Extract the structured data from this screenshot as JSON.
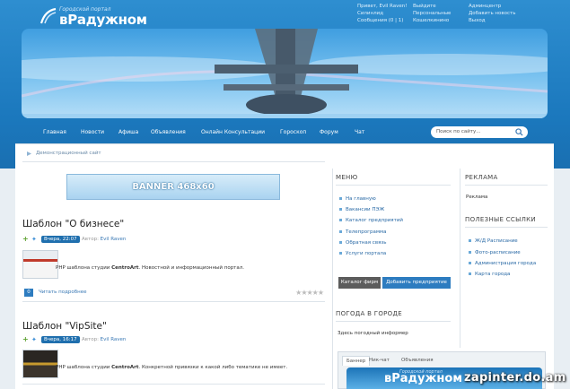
{
  "site": {
    "logo_subtitle": "Городской портал",
    "logo_title": "вРадужном"
  },
  "user_panel": {
    "col1": [
      "Привет, Evil Raven!",
      "Силинлид",
      "Сообщения (0 | 1)"
    ],
    "col2": [
      "Выйдите",
      "Персональные",
      "Кошелкинино"
    ],
    "col3": [
      "Админцентр",
      "Добавить новость",
      "Выход"
    ]
  },
  "nav": {
    "items": [
      "Главная",
      "Новости",
      "Афиша",
      "Объявления",
      "Онлайн Консультации",
      "Гороскоп",
      "Форум",
      "Чат"
    ]
  },
  "search": {
    "placeholder": "Поиск по сайту..."
  },
  "breadcrumb": {
    "text": "Демонстрационный сайт"
  },
  "banner_ad": {
    "label": "BANNER 468x60"
  },
  "posts": [
    {
      "title": "Шаблон \"О бизнесе\"",
      "date": "Вчера, 22:07",
      "author_label": "Автор:",
      "author": "Evil Raven",
      "desc_prefix": "PHP шаблона студии ",
      "desc_brand": "CentroArt",
      "desc_rest": ". Новостной и информационный портал.",
      "comments": "0",
      "more": "Читать подробнее"
    },
    {
      "title": "Шаблон \"VipSite\"",
      "date": "Вчера, 16:17",
      "author_label": "Автор:",
      "author": "Evil Raven",
      "desc_prefix": "PHP шаблона студии ",
      "desc_brand": "CentroArt",
      "desc_rest": ". Конкретной привязки к какой либо тематике не имеет."
    }
  ],
  "menu": {
    "title": "МЕНЮ",
    "items": [
      "На главную",
      "Вакансии ПЭЖ",
      "Каталог предприятий",
      "Телепрограмма",
      "Обратная связь",
      "Услуги портала"
    ],
    "btn_catalog": "Каталог фирм",
    "btn_add": "Добавить предприятие"
  },
  "weather": {
    "title": "ПОГОДА В ГОРОДЕ",
    "text": "Здесь погодный информер"
  },
  "tabs": [
    "Баннер",
    "Ник-чат",
    "Объявления"
  ],
  "ad_block": {
    "title": "РЕКЛАМА",
    "text": "Реклама"
  },
  "links": {
    "title": "ПОЛЕЗНЫЕ ССЫЛКИ",
    "items": [
      "Ж/Д Расписание",
      "Фото-расписание",
      "Администрация города",
      "Карта города"
    ]
  },
  "watermark": "zapinter.do.am",
  "colors": {
    "brand_blue": "#1b78bd",
    "accent": "#2d7cc0",
    "link": "#2a6aa6"
  }
}
